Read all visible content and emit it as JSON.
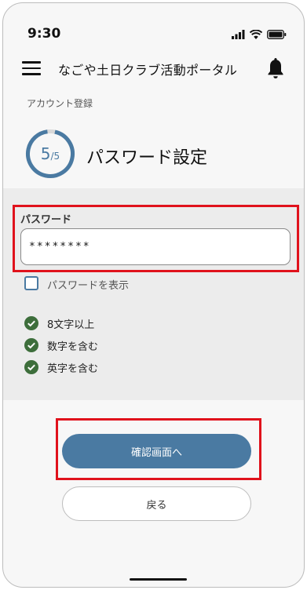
{
  "status_bar": {
    "time": "9:30"
  },
  "header": {
    "title": "なごや土日クラブ活動ポータル"
  },
  "breadcrumb": "アカウント登録",
  "progress": {
    "current": "5",
    "total": "/5",
    "fraction": 1.0
  },
  "page_title": "パスワード設定",
  "form": {
    "password_label": "パスワード",
    "password_value": "********",
    "show_password_label": "パスワードを表示",
    "show_password_checked": false,
    "rules": [
      {
        "text": "8文字以上",
        "met": true
      },
      {
        "text": "数字を含む",
        "met": true
      },
      {
        "text": "英字を含む",
        "met": true
      }
    ]
  },
  "buttons": {
    "confirm": "確認画面へ",
    "back": "戻る"
  },
  "colors": {
    "accent": "#4a7aa2",
    "success": "#3d6e3b",
    "highlight": "#e0121c",
    "panel": "#ececec"
  }
}
